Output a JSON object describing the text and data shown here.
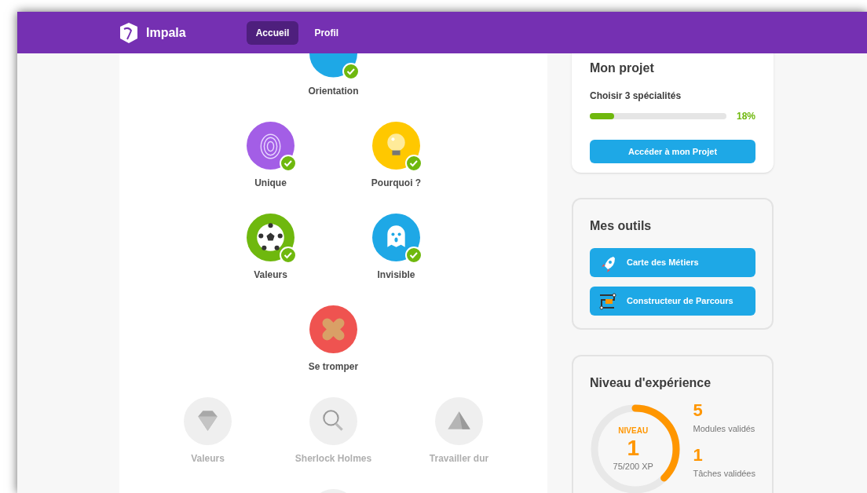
{
  "header": {
    "brand": "Impala",
    "nav": [
      {
        "label": "Accueil",
        "selected": true
      },
      {
        "label": "Profil",
        "selected": false
      }
    ]
  },
  "skill_rows": [
    [
      {
        "label": "Orientation",
        "completed": true,
        "locked": false,
        "color": "#1ea8e6"
      }
    ],
    [
      {
        "label": "Unique",
        "completed": true,
        "locked": false,
        "color": "#a35ee6"
      },
      {
        "label": "Pourquoi ?",
        "completed": true,
        "locked": false,
        "color": "#ffc800"
      }
    ],
    [
      {
        "label": "Valeurs",
        "completed": true,
        "locked": false,
        "color": "#6fb80e"
      },
      {
        "label": "Invisible",
        "completed": true,
        "locked": false,
        "color": "#1ea8e6"
      }
    ],
    [
      {
        "label": "Se tromper",
        "completed": false,
        "locked": false,
        "color": "#ef5350"
      }
    ],
    [
      {
        "label": "Valeurs",
        "completed": false,
        "locked": true
      },
      {
        "label": "Sherlock Holmes",
        "completed": false,
        "locked": true
      },
      {
        "label": "Travailler dur",
        "completed": false,
        "locked": true
      }
    ],
    [
      {
        "completed": false,
        "locked": true
      }
    ]
  ],
  "project": {
    "title": "Mon projet",
    "task": "Choisir 3 spécialités",
    "level": 0.18,
    "reading": "18%",
    "button": "Accéder à mon Projet"
  },
  "tools": {
    "title": "Mes outils",
    "items": [
      "Carte des Métiers",
      "Constructeur de Parcours"
    ]
  },
  "experience": {
    "title": "Niveau d'expérience",
    "caption": "NIVEAU",
    "value": "1",
    "xp": "75/200 XP",
    "level": 0.375,
    "stats": [
      {
        "value": "5",
        "label": "Modules validés"
      },
      {
        "value": "1",
        "label": "Tâches validées"
      }
    ]
  }
}
